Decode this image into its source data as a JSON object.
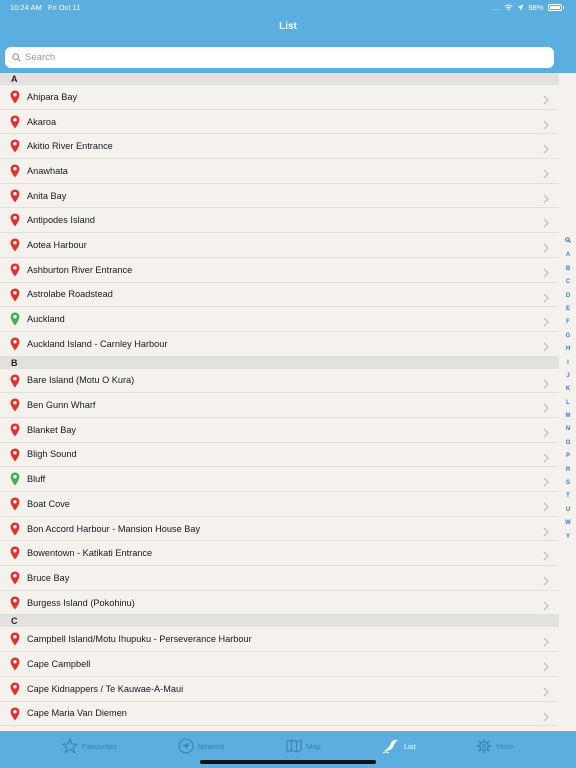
{
  "status": {
    "time": "10:24 AM",
    "date": "Fri Oct 11",
    "signal": "....",
    "battery": "98%"
  },
  "nav": {
    "title": "List"
  },
  "search": {
    "placeholder": "Search"
  },
  "colors": {
    "header": "#5aaee0",
    "pin_red": "#e3312c",
    "pin_green": "#3db44a",
    "index_blue": "#2a7fdb"
  },
  "sections": [
    {
      "letter": "A",
      "items": [
        {
          "name": "Ahipara Bay",
          "pin": "red"
        },
        {
          "name": "Akaroa",
          "pin": "red"
        },
        {
          "name": "Akitio River Entrance",
          "pin": "red"
        },
        {
          "name": "Anawhata",
          "pin": "red"
        },
        {
          "name": "Anita Bay",
          "pin": "red"
        },
        {
          "name": "Antipodes Island",
          "pin": "red"
        },
        {
          "name": "Aotea Harbour",
          "pin": "red"
        },
        {
          "name": "Ashburton River Entrance",
          "pin": "red"
        },
        {
          "name": "Astrolabe Roadstead",
          "pin": "red"
        },
        {
          "name": "Auckland",
          "pin": "green"
        },
        {
          "name": "Auckland Island - Carnley Harbour",
          "pin": "red"
        }
      ]
    },
    {
      "letter": "B",
      "items": [
        {
          "name": "Bare Island (Motu O Kura)",
          "pin": "red"
        },
        {
          "name": "Ben Gunn Wharf",
          "pin": "red"
        },
        {
          "name": "Blanket Bay",
          "pin": "red"
        },
        {
          "name": "Bligh Sound",
          "pin": "red"
        },
        {
          "name": "Bluff",
          "pin": "green"
        },
        {
          "name": "Boat Cove",
          "pin": "red"
        },
        {
          "name": "Bon Accord Harbour - Mansion House Bay",
          "pin": "red"
        },
        {
          "name": "Bowentown - Katikati Entrance",
          "pin": "red"
        },
        {
          "name": "Bruce Bay",
          "pin": "red"
        },
        {
          "name": "Burgess Island (Pokohinu)",
          "pin": "red"
        }
      ]
    },
    {
      "letter": "C",
      "items": [
        {
          "name": "Campbell Island/Motu Ihupuku - Perseverance Harbour",
          "pin": "red"
        },
        {
          "name": "Cape Campbell",
          "pin": "red"
        },
        {
          "name": "Cape Kidnappers / Te Kauwae-A-Maui",
          "pin": "red"
        },
        {
          "name": "Cape Maria Van Diemen",
          "pin": "red"
        }
      ]
    }
  ],
  "index_letters": [
    "A",
    "B",
    "C",
    "D",
    "E",
    "F",
    "G",
    "H",
    "I",
    "J",
    "K",
    "L",
    "M",
    "N",
    "O",
    "P",
    "R",
    "S",
    "T",
    "U",
    "W",
    "Y"
  ],
  "tabs": [
    {
      "label": "Favourites",
      "icon": "star-icon",
      "active": false
    },
    {
      "label": "Nearest",
      "icon": "navigation-arrow-icon",
      "active": false
    },
    {
      "label": "Map",
      "icon": "map-icon",
      "active": false
    },
    {
      "label": "List",
      "icon": "list-wave-icon",
      "active": true
    },
    {
      "label": "More",
      "icon": "gear-icon",
      "active": false
    }
  ]
}
